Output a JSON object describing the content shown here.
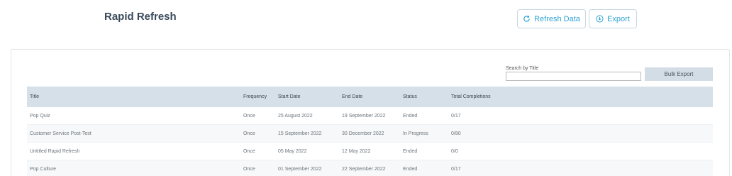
{
  "header": {
    "title": "Rapid Refresh",
    "refresh_label": "Refresh Data",
    "export_label": "Export"
  },
  "toolbar": {
    "search_label": "Search by Title",
    "search_value": "",
    "bulk_export_label": "Bulk Export"
  },
  "table": {
    "columns": [
      "Title",
      "Frequency",
      "Start Date",
      "End Date",
      "Status",
      "Total Completions"
    ],
    "rows": [
      {
        "title": "Pop Quiz",
        "frequency": "Once",
        "start": "25 August 2022",
        "end": "19 September 2022",
        "status": "Ended",
        "total": "0/17"
      },
      {
        "title": "Customer Service Post-Test",
        "frequency": "Once",
        "start": "15 September 2022",
        "end": "30 December 2022",
        "status": "In Progress",
        "total": "0/80"
      },
      {
        "title": "Untitled Rapid Refresh",
        "frequency": "Once",
        "start": "05 May 2022",
        "end": "12 May 2022",
        "status": "Ended",
        "total": "0/0"
      },
      {
        "title": "Pop Culture",
        "frequency": "Once",
        "start": "01 September 2022",
        "end": "22 September 2022",
        "status": "Ended",
        "total": "0/17"
      }
    ]
  },
  "colors": {
    "accent": "#2fa3d4",
    "header_bg": "#d6e0e8",
    "bulk_button_bg": "#d3dde5"
  },
  "icons": {
    "refresh": "refresh-icon",
    "export": "download-circle-icon"
  }
}
